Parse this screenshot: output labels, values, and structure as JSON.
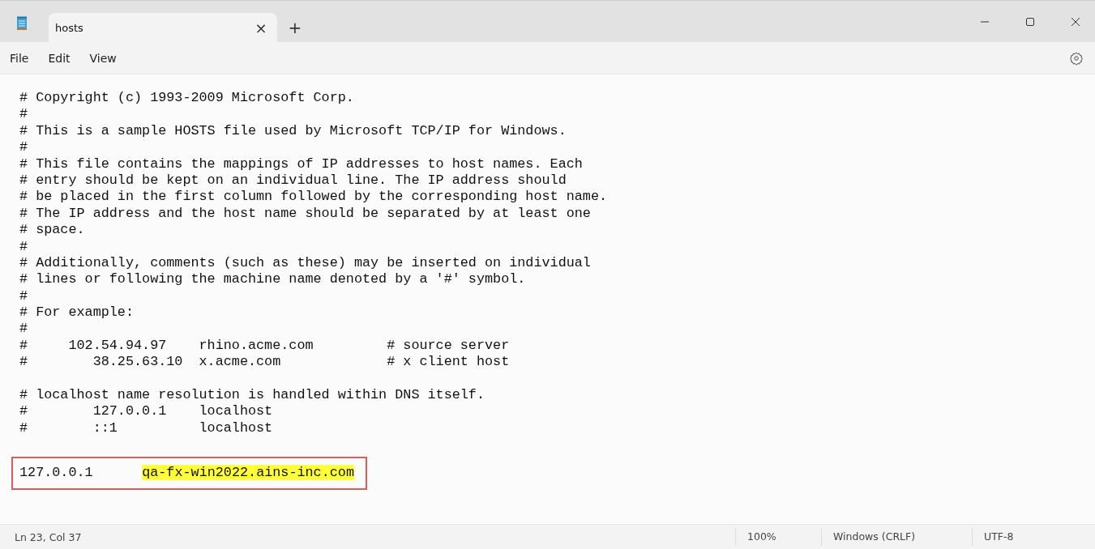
{
  "tab": {
    "title": "hosts",
    "selected": true,
    "close": "×"
  },
  "new_tab": "+",
  "menu": [
    "File",
    "Edit",
    "View"
  ],
  "editor": {
    "lines": [
      {
        "kind": "text",
        "text": "# Copyright (c) 1993-2009 Microsoft Corp."
      },
      {
        "kind": "text",
        "text": "#"
      },
      {
        "kind": "text",
        "text": "# This is a sample HOSTS file used by Microsoft TCP/IP for Windows."
      },
      {
        "kind": "text",
        "text": "#"
      },
      {
        "kind": "text",
        "text": "# This file contains the mappings of IP addresses to host names. Each"
      },
      {
        "kind": "text",
        "text": "# entry should be kept on an individual line. The IP address should"
      },
      {
        "kind": "text",
        "text": "# be placed in the first column followed by the corresponding host name."
      },
      {
        "kind": "text",
        "text": "# The IP address and the host name should be separated by at least one"
      },
      {
        "kind": "text",
        "text": "# space."
      },
      {
        "kind": "text",
        "text": "#"
      },
      {
        "kind": "text",
        "text": "# Additionally, comments (such as these) may be inserted on individual"
      },
      {
        "kind": "text",
        "text": "# lines or following the machine name denoted by a '#' symbol."
      },
      {
        "kind": "text",
        "text": "#"
      },
      {
        "kind": "text",
        "text": "# For example:"
      },
      {
        "kind": "text",
        "text": "#"
      },
      {
        "kind": "text",
        "text": "#     102.54.94.97    rhino.acme.com         # source server"
      },
      {
        "kind": "text",
        "text": "#        38.25.63.10  x.acme.com             # x client host"
      },
      {
        "kind": "blank"
      },
      {
        "kind": "text",
        "text": "# localhost name resolution is handled within DNS itself."
      },
      {
        "kind": "text",
        "text": "#        127.0.0.1    localhost"
      },
      {
        "kind": "text",
        "text": "#        ::1          localhost"
      },
      {
        "kind": "blank"
      }
    ],
    "last_line": {
      "address": "127.0.0.1",
      "hostname": "qa-fx-win2022.ains-inc.com",
      "outlined": true,
      "hostname_selected": true
    }
  },
  "status_bar": {
    "position": "Ln 23, Col 37",
    "zoom": "100%",
    "line_ending": "Windows (CRLF)",
    "encoding": "UTF-8"
  }
}
